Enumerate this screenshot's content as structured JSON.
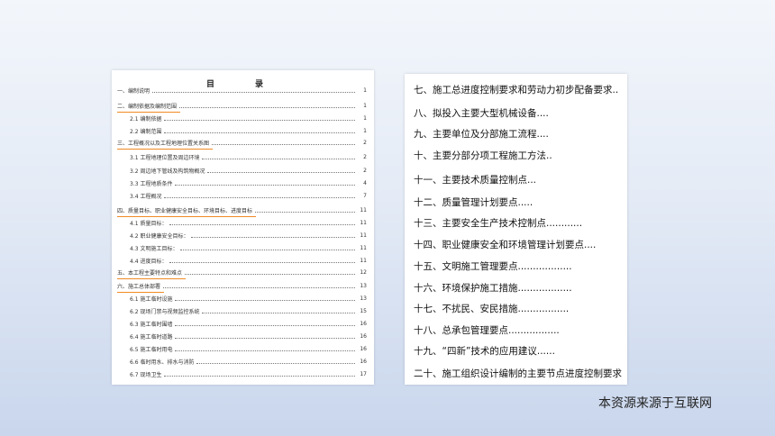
{
  "left_doc": {
    "title": "目　录",
    "items": [
      {
        "label": "一、编制说明",
        "page": "1",
        "level": 1,
        "hl": false
      },
      {
        "label": "二、编制依据及编制范围",
        "page": "1",
        "level": 1,
        "hl": true
      },
      {
        "label": "2.1 编制依据",
        "page": "1",
        "level": 2,
        "hl": false
      },
      {
        "label": "2.2 编制范围",
        "page": "1",
        "level": 2,
        "hl": false
      },
      {
        "label": "三、工程概况以及工程地理位置关系图",
        "page": "2",
        "level": 1,
        "hl": true
      },
      {
        "label": "3.1 工程地理位置及周边环境",
        "page": "2",
        "level": 2,
        "hl": false
      },
      {
        "label": "3.2 周边地下管线及构筑物概况",
        "page": "2",
        "level": 2,
        "hl": false
      },
      {
        "label": "3.3 工程地质条件",
        "page": "4",
        "level": 2,
        "hl": false
      },
      {
        "label": "3.4 工程概况",
        "page": "7",
        "level": 2,
        "hl": false
      },
      {
        "label": "四、质量目标、职业健康安全目标、环境目标、进度目标",
        "page": "11",
        "level": 1,
        "hl": true
      },
      {
        "label": "4.1 质量目标：",
        "page": "11",
        "level": 2,
        "hl": false
      },
      {
        "label": "4.2 职业健康安全目标：",
        "page": "11",
        "level": 2,
        "hl": false
      },
      {
        "label": "4.3 文明施工目标：",
        "page": "11",
        "level": 2,
        "hl": false
      },
      {
        "label": "4.4 进度目标：",
        "page": "11",
        "level": 2,
        "hl": false
      },
      {
        "label": "五、本工程主要特点和难点",
        "page": "12",
        "level": 1,
        "hl": true
      },
      {
        "label": "六、施工总体部署",
        "page": "13",
        "level": 1,
        "hl": true
      },
      {
        "label": "6.1 施工临时设施",
        "page": "13",
        "level": 2,
        "hl": false
      },
      {
        "label": "6.2 现场门禁与视频监控系统",
        "page": "15",
        "level": 2,
        "hl": false
      },
      {
        "label": "6.3 施工临时围墙",
        "page": "16",
        "level": 2,
        "hl": false
      },
      {
        "label": "6.4 施工临时道路",
        "page": "16",
        "level": 2,
        "hl": false
      },
      {
        "label": "6.5 施工临时用电",
        "page": "16",
        "level": 2,
        "hl": false
      },
      {
        "label": "6.6 临时用水、排水与消防",
        "page": "16",
        "level": 2,
        "hl": false
      },
      {
        "label": "6.7 现场卫生",
        "page": "17",
        "level": 2,
        "hl": false
      }
    ]
  },
  "right_doc": {
    "items": [
      "七、施工总进度控制要求和劳动力初步配备要求..",
      "八、拟投入主要大型机械设备....",
      "九、主要单位及分部施工流程....",
      "十、主要分部分项工程施工方法..",
      "十一、主要技术质量控制点...",
      "十二、质量管理计划要点.....",
      "十三、主要安全生产技术控制点............",
      "十四、职业健康安全和环境管理计划要点....",
      "十五、文明施工管理要点..................",
      "十六、环境保护施工措施..................",
      "十七、不扰民、安民措施.................",
      "十八、总承包管理要点.................",
      "十九、“四新”技术的应用建议......",
      "二十、施工组织设计编制的主要节点进度控制要求"
    ]
  },
  "source_note": "本资源来源于互联网"
}
